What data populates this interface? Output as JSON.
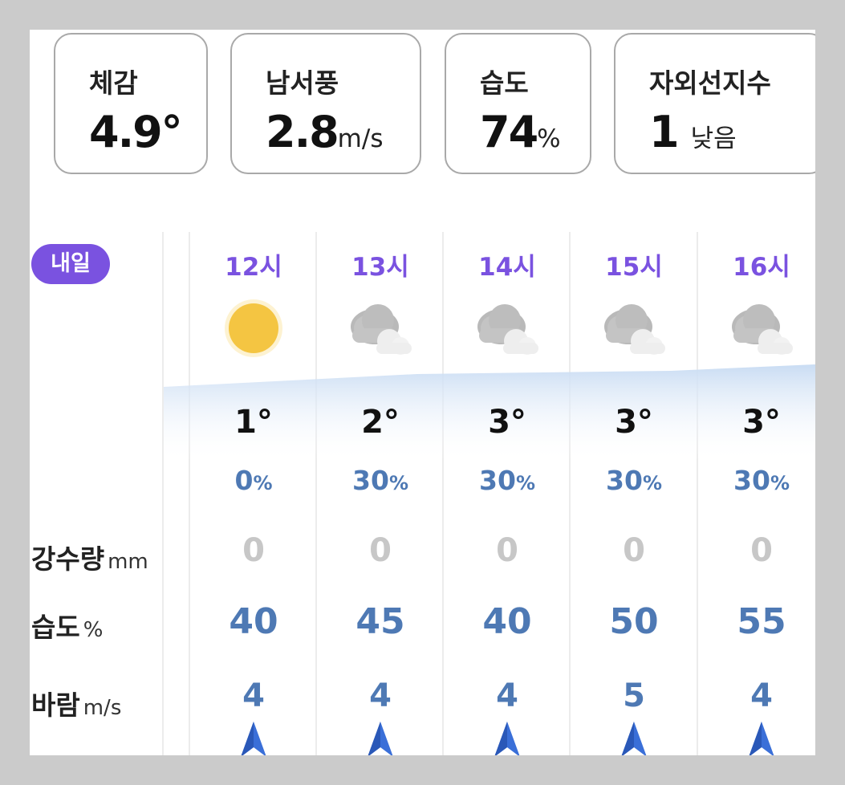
{
  "summary": {
    "feels_like": {
      "label": "체감",
      "value": "4.9°"
    },
    "wind": {
      "label": "남서풍",
      "value": "2.8",
      "unit": "m/s"
    },
    "humidity": {
      "label": "습도",
      "value": "74",
      "unit": "%"
    },
    "uv": {
      "label": "자외선지수",
      "value": "1",
      "level": "낮음"
    }
  },
  "day_badge": "내일",
  "row_labels": {
    "rain": {
      "label": "강수량",
      "unit": "mm"
    },
    "humidity": {
      "label": "습도",
      "unit": "%"
    },
    "wind": {
      "label": "바람",
      "unit": "m/s"
    }
  },
  "hours": [
    {
      "time": "12시",
      "icon": "sun-icon",
      "temp": "1°",
      "pop": "0",
      "pop_unit": "%",
      "rain": "0",
      "humidity": "40",
      "wind": "4"
    },
    {
      "time": "13시",
      "icon": "cloud-icon",
      "temp": "2°",
      "pop": "30",
      "pop_unit": "%",
      "rain": "0",
      "humidity": "45",
      "wind": "4"
    },
    {
      "time": "14시",
      "icon": "cloud-icon",
      "temp": "3°",
      "pop": "30",
      "pop_unit": "%",
      "rain": "0",
      "humidity": "40",
      "wind": "4"
    },
    {
      "time": "15시",
      "icon": "cloud-icon",
      "temp": "3°",
      "pop": "30",
      "pop_unit": "%",
      "rain": "0",
      "humidity": "50",
      "wind": "5"
    },
    {
      "time": "16시",
      "icon": "cloud-icon",
      "temp": "3°",
      "pop": "30",
      "pop_unit": "%",
      "rain": "0",
      "humidity": "55",
      "wind": "4"
    }
  ],
  "colors": {
    "accent": "#7a52e0",
    "value_blue": "#4e79b4",
    "arrow_blue": "#3a6fd8",
    "muted": "#c7c7c7",
    "sun": "#f4c542"
  }
}
